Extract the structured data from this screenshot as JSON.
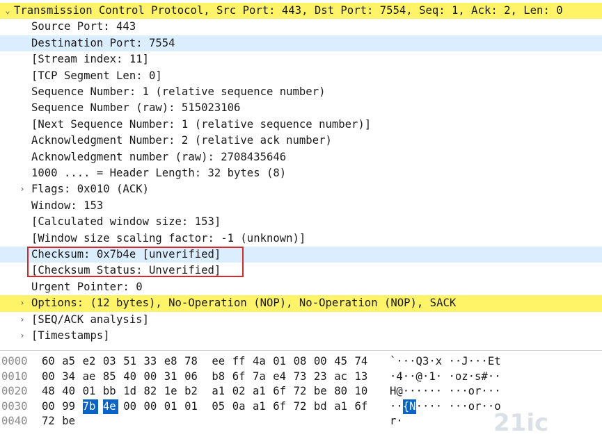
{
  "tree": [
    {
      "text": "Transmission Control Protocol, Src Port: 443, Dst Port: 7554, Seq: 1, Ack: 2, Len: 0",
      "arrow": "⌄",
      "level": 0,
      "highlight": "yellow"
    },
    {
      "text": "Source Port: 443",
      "level": 1
    },
    {
      "text": "Destination Port: 7554",
      "level": 1,
      "highlight": "selected"
    },
    {
      "text": "[Stream index: 11]",
      "level": 1
    },
    {
      "text": "[TCP Segment Len: 0]",
      "level": 1
    },
    {
      "text": "Sequence Number: 1    (relative sequence number)",
      "level": 1
    },
    {
      "text": "Sequence Number (raw): 515023106",
      "level": 1
    },
    {
      "text": "[Next Sequence Number: 1    (relative sequence number)]",
      "level": 1
    },
    {
      "text": "Acknowledgment Number: 2    (relative ack number)",
      "level": 1
    },
    {
      "text": "Acknowledgment number (raw): 2708435646",
      "level": 1
    },
    {
      "text": "1000 .... = Header Length: 32 bytes (8)",
      "level": 1
    },
    {
      "text": "Flags: 0x010 (ACK)",
      "arrow": "›",
      "level": 1
    },
    {
      "text": "Window: 153",
      "level": 1
    },
    {
      "text": "[Calculated window size: 153]",
      "level": 1
    },
    {
      "text": "[Window size scaling factor: -1 (unknown)]",
      "level": 1
    },
    {
      "text": "Checksum: 0x7b4e [unverified]",
      "level": 1,
      "highlight": "selected"
    },
    {
      "text": "[Checksum Status: Unverified]",
      "level": 1
    },
    {
      "text": "Urgent Pointer: 0",
      "level": 1
    },
    {
      "text": "Options: (12 bytes), No-Operation (NOP), No-Operation (NOP), SACK",
      "arrow": "›",
      "level": 1,
      "highlight": "yellow"
    },
    {
      "text": "[SEQ/ACK analysis]",
      "arrow": "›",
      "level": 1
    },
    {
      "text": "[Timestamps]",
      "arrow": "›",
      "level": 1
    }
  ],
  "hex": [
    {
      "offset": "0000",
      "bytes": [
        "60",
        "a5",
        "e2",
        "03",
        "51",
        "33",
        "e8",
        "78",
        "ee",
        "ff",
        "4a",
        "01",
        "08",
        "00",
        "45",
        "74"
      ],
      "ascii": "`···Q3·x ··J···Et"
    },
    {
      "offset": "0010",
      "bytes": [
        "00",
        "34",
        "ae",
        "85",
        "40",
        "00",
        "31",
        "06",
        "b8",
        "6f",
        "7a",
        "e4",
        "73",
        "23",
        "ac",
        "13"
      ],
      "ascii": "·4··@·1· ·oz·s#··"
    },
    {
      "offset": "0020",
      "bytes": [
        "48",
        "40",
        "01",
        "bb",
        "1d",
        "82",
        "1e",
        "b2",
        "a1",
        "02",
        "a1",
        "6f",
        "72",
        "be",
        "80",
        "10"
      ],
      "ascii": "H@······ ···or···"
    },
    {
      "offset": "0030",
      "bytes": [
        "00",
        "99",
        "7b",
        "4e",
        "00",
        "00",
        "01",
        "01",
        "05",
        "0a",
        "a1",
        "6f",
        "72",
        "bd",
        "a1",
        "6f"
      ],
      "ascii": "··{N···· ···or··o",
      "highlight_bytes": [
        2,
        3
      ],
      "ascii_highlight": "{N"
    },
    {
      "offset": "0040",
      "bytes": [
        "72",
        "be"
      ],
      "ascii": "r·"
    }
  ],
  "colors": {
    "selected": "#dbeeff",
    "yellow": "#fff468",
    "redbox": "#d8262b",
    "byte_highlight": "#0a64c8"
  }
}
